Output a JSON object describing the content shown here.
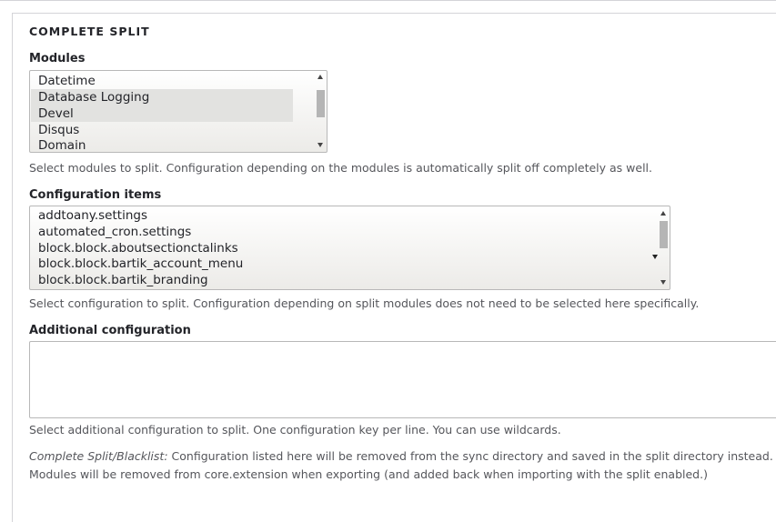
{
  "fieldset": {
    "legend": "COMPLETE SPLIT"
  },
  "modules": {
    "label": "Modules",
    "options": [
      {
        "label": "Datetime",
        "selected": false
      },
      {
        "label": "Database Logging",
        "selected": true
      },
      {
        "label": "Devel",
        "selected": true
      },
      {
        "label": "Disqus",
        "selected": false
      },
      {
        "label": "Domain",
        "selected": false
      }
    ],
    "description": "Select modules to split. Configuration depending on the modules is automatically split off completely as well."
  },
  "config_items": {
    "label": "Configuration items",
    "options": [
      {
        "label": "addtoany.settings",
        "selected": false
      },
      {
        "label": "automated_cron.settings",
        "selected": false
      },
      {
        "label": "block.block.aboutsectionctalinks",
        "selected": false
      },
      {
        "label": "block.block.bartik_account_menu",
        "selected": false
      },
      {
        "label": "block.block.bartik_branding",
        "selected": false
      }
    ],
    "description": "Select configuration to split. Configuration depending on split modules does not need to be selected here specifically."
  },
  "additional": {
    "label": "Additional configuration",
    "value": "",
    "description": "Select additional configuration to split. One configuration key per line. You can use wildcards."
  },
  "help": {
    "line1_em": "Complete Split/Blacklist:",
    "line1_rest": " Configuration listed here will be removed from the sync directory and saved in the split directory instead.",
    "line2": "Modules will be removed from core.extension when exporting (and added back when importing with the split enabled.)"
  },
  "icons": {
    "scroll_up": "scroll-up-arrow-icon",
    "scroll_down": "scroll-down-arrow-icon"
  }
}
